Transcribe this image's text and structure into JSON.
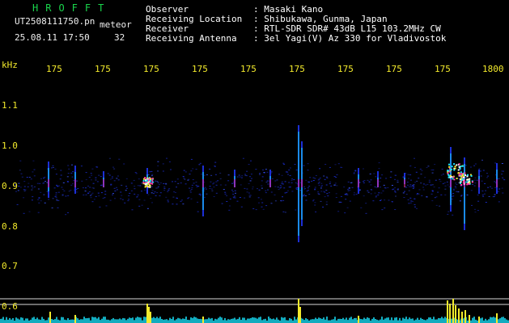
{
  "header": {
    "logo": "HROFFT",
    "file_name": "UT2508111750.pn",
    "tag": "meteor",
    "date_time": "25.08.11 17:50",
    "count": "32",
    "fields": [
      {
        "key": "Observer",
        "value": ": Masaki Kano"
      },
      {
        "key": "Receiving Location",
        "value": ": Shibukawa, Gunma, Japan"
      },
      {
        "key": "Receiver",
        "value": ": RTL-SDR SDR# 43dB L15 103.2MHz CW"
      },
      {
        "key": "Receiving Antenna",
        "value": ": 3el Yagi(V) Az 330 for Vladivostok"
      }
    ]
  },
  "axes": {
    "y_unit": "kHz",
    "x_ticks": [
      "175",
      "175",
      "175",
      "175",
      "175",
      "175",
      "175",
      "175",
      "175",
      "1800"
    ],
    "y_ticks": [
      "1.1",
      "1.0",
      "0.9",
      "0.8",
      "0.7",
      "0.6"
    ]
  },
  "colors": {
    "background": "#000000",
    "axis_text": "#f3ea2c",
    "logo": "#19d54c",
    "header_text": "#ffffff",
    "noise": "#1c2fd6",
    "trace": "#19e6ff",
    "trace_peak": "#f3ea2c",
    "hot": "#ff3aa0"
  }
}
